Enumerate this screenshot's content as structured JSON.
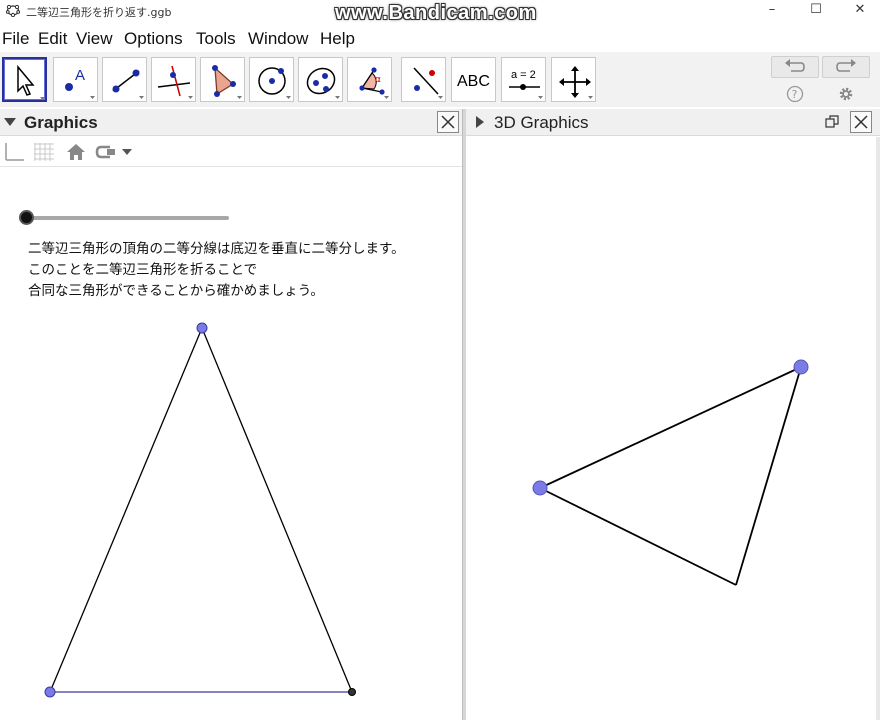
{
  "window": {
    "title": "二等辺三角形を折り返す.ggb",
    "watermark": "www.Bandicam.com",
    "minimize": "–",
    "maximize": "☐",
    "close": "✕"
  },
  "menu": [
    "File",
    "Edit",
    "View",
    "Options",
    "Tools",
    "Window",
    "Help"
  ],
  "toolbar": {
    "tools": [
      {
        "name": "move-tool",
        "icon": "cursor-arrow-icon",
        "active": true
      },
      {
        "name": "point-tool",
        "icon": "point-a-icon",
        "label": "A"
      },
      {
        "name": "line-tool",
        "icon": "line-through-points-icon"
      },
      {
        "name": "perpendicular-tool",
        "icon": "perpendicular-line-icon"
      },
      {
        "name": "polygon-tool",
        "icon": "polygon-icon"
      },
      {
        "name": "circle-tool",
        "icon": "circle-center-point-icon"
      },
      {
        "name": "conic-tool",
        "icon": "ellipse-icon"
      },
      {
        "name": "angle-tool",
        "icon": "angle-icon",
        "label": "α"
      },
      {
        "name": "reflect-tool",
        "icon": "reflect-line-icon"
      },
      {
        "name": "text-tool",
        "icon": "abc-text-icon",
        "label": "ABC"
      },
      {
        "name": "slider-tool",
        "icon": "slider-icon",
        "label": "a = 2"
      },
      {
        "name": "move-view-tool",
        "icon": "move-graphics-icon"
      }
    ],
    "undo_icon": "undo-icon",
    "redo_icon": "redo-icon",
    "help_icon": "help-icon",
    "settings_icon": "gear-icon"
  },
  "graphics": {
    "title": "Graphics",
    "slider": {
      "value": 0
    },
    "description": [
      "二等辺三角形の頂角の二等分線は底辺を垂直に二等分します。",
      "このことを二等辺三角形を折ることで",
      "合同な三角形ができることから確かめましょう。"
    ]
  },
  "graphics3d": {
    "title": "3D Graphics"
  },
  "colors": {
    "point_fill": "#7b7be6",
    "point_stroke": "#3a3aa0",
    "active_tool_border": "#2a2f99",
    "header_bg": "#f0f0f0"
  }
}
